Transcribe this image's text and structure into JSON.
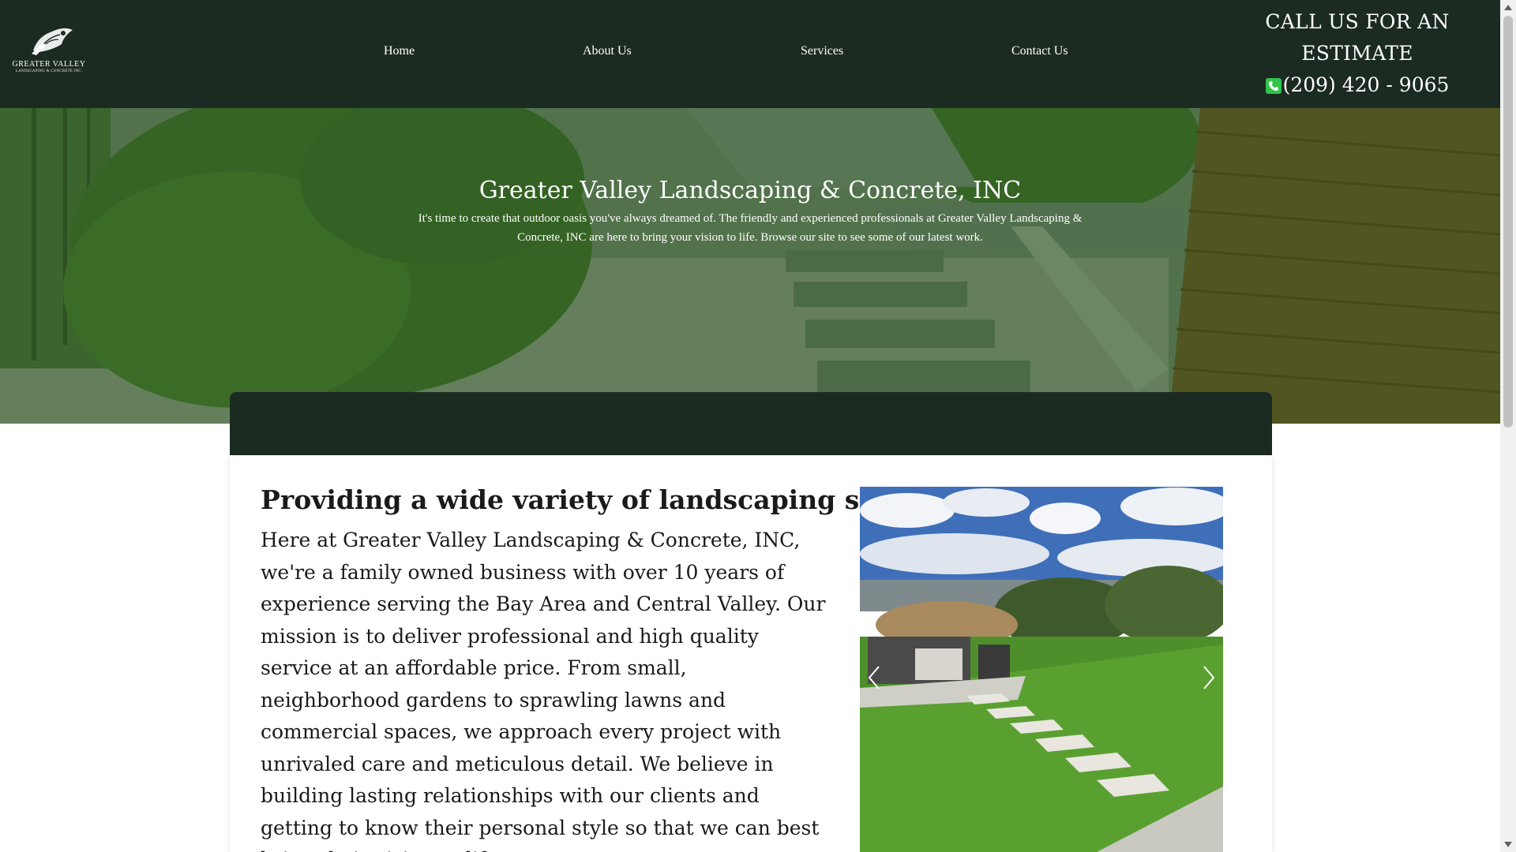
{
  "header": {
    "logo": {
      "name": "GREATER VALLEY",
      "subtitle": "LANDSCAPING & CONCRETE INC."
    },
    "nav": [
      {
        "label": "Home"
      },
      {
        "label": "About Us"
      },
      {
        "label": "Services"
      },
      {
        "label": "Contact Us"
      }
    ],
    "cta": {
      "line1": "CALL US FOR AN",
      "line2": "ESTIMATE",
      "phone": "(209) 420 - 9065",
      "icon": "phone-icon"
    }
  },
  "hero": {
    "title": "Greater Valley Landscaping & Concrete, INC",
    "text": "It's time to create that outdoor oasis you've always dreamed of. The friendly and experienced professionals at Greater Valley Landscaping & Concrete, INC are here to bring your vision to life. Browse our site to see some of our latest work."
  },
  "about": {
    "title": "Providing a wide variety of landscaping services",
    "body": "Here at Greater Valley Landscaping & Concrete, INC, we're a family owned business with over 10 years of experience serving the Bay Area and Central Valley. Our mission is to deliver professional and high quality service at an affordable price. From small, neighborhood gardens to sprawling lawns and commercial spaces, we approach every project with unrivaled care and meticulous detail. We believe in building lasting relationships with our clients and getting to know their personal style so that we can best bring their vision to life."
  },
  "slider": {
    "prev_icon": "chevron-left-icon",
    "next_icon": "chevron-right-icon"
  },
  "colors": {
    "header_bg": "#1c2b22",
    "hero_overlay": "#20521c",
    "phone_icon": "#31c44a",
    "text": "#1a1a1a"
  }
}
